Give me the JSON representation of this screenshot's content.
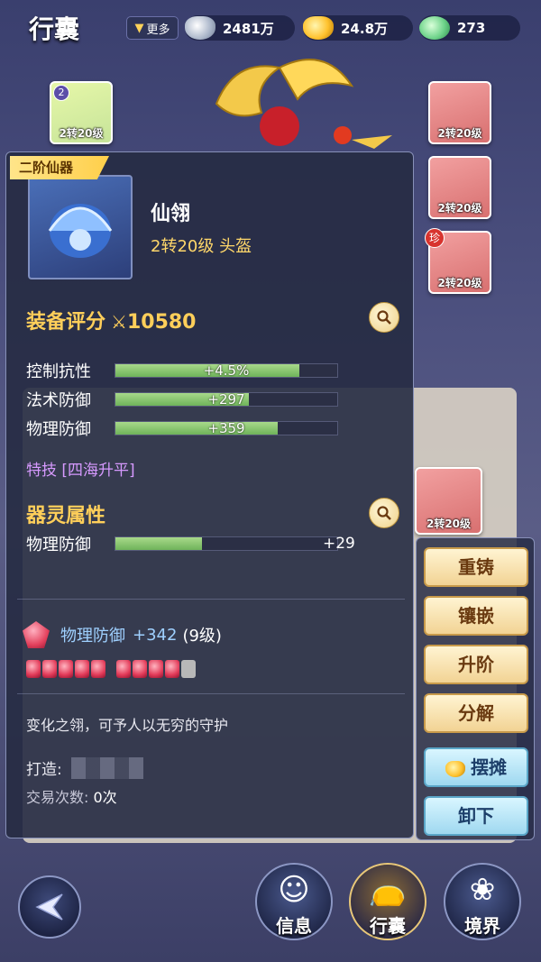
{
  "header": {
    "title": "行囊",
    "more_label": "更多",
    "currencies": [
      {
        "name": "silver-ingot-icon",
        "value": "2481万"
      },
      {
        "name": "gold-ingot-icon",
        "value": "24.8万"
      },
      {
        "name": "jade-icon",
        "value": "273"
      }
    ]
  },
  "equipment_slots": {
    "left_top": {
      "badge": "2",
      "label": "2转20级"
    },
    "right": [
      {
        "label": "2转20级"
      },
      {
        "label": "2转20级"
      },
      {
        "label": "2转20级",
        "badge": "珍"
      }
    ],
    "bag_highlight": {
      "label": "2转20级"
    }
  },
  "item": {
    "tier_tag": "二阶仙器",
    "name": "仙翎",
    "subtitle": "2转20级 头盔",
    "score_label": "装备评分",
    "score_value": "10580",
    "stats": [
      {
        "name": "控制抗性",
        "value": "+4.5%",
        "fill": 0.83
      },
      {
        "name": "法术防御",
        "value": "+297",
        "fill": 0.6
      },
      {
        "name": "物理防御",
        "value": "+359",
        "fill": 0.73
      }
    ],
    "special": "特技 [四海升平]",
    "soul_title": "器灵属性",
    "soul_stats": [
      {
        "name": "物理防御",
        "value": "+29",
        "fill": 0.39
      }
    ],
    "gem": {
      "name": "物理防御",
      "bonus": "+342",
      "level": "(9级)",
      "filled": 9,
      "total": 10
    },
    "description": "变化之翎，可予人以无穷的守护",
    "forge_label": "打造:",
    "trade_label": "交易次数:",
    "trade_value": "0次"
  },
  "actions": {
    "recast": "重铸",
    "inlay": "镶嵌",
    "upgrade": "升阶",
    "decompose": "分解",
    "stall": "摆摊",
    "unequip": "卸下"
  },
  "nav": {
    "info": "信息",
    "bag": "行囊",
    "realm": "境界"
  },
  "colors": {
    "accent_gold": "#ffcf5a",
    "stat_bar": "#6fb35a",
    "special_purple": "#d79aff",
    "gem_blue": "#9fd0ff"
  }
}
